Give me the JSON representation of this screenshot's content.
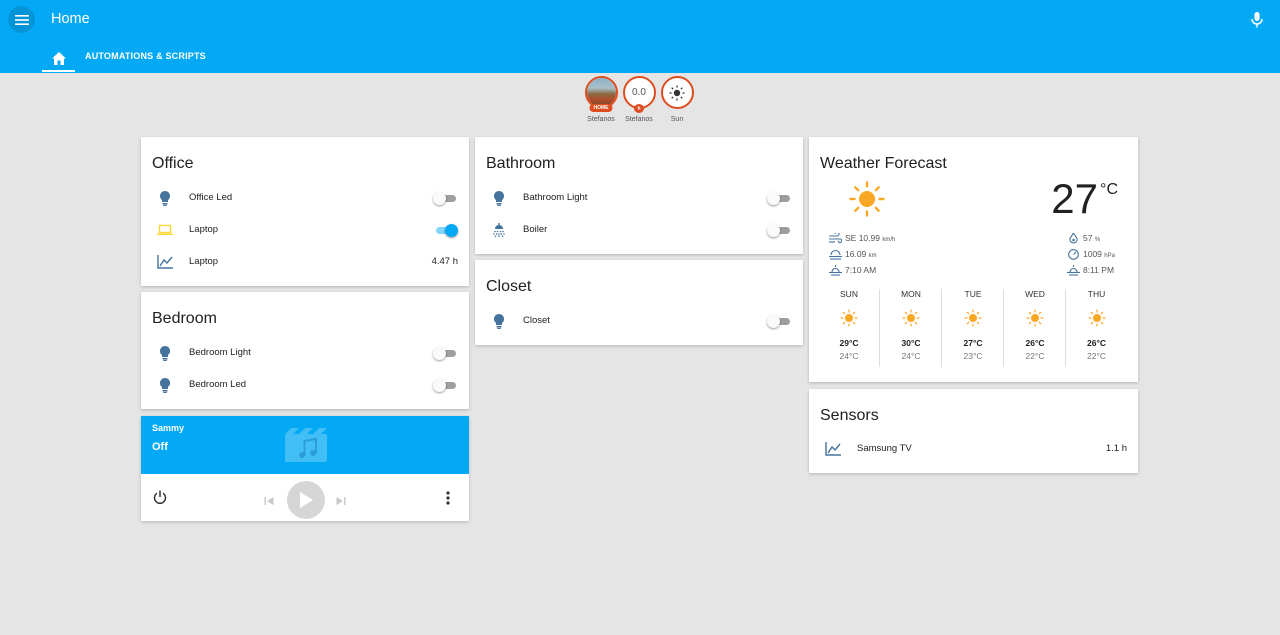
{
  "header": {
    "title": "Home",
    "tabs": [
      {
        "label": "AUTOMATIONS & SCRIPTS"
      }
    ]
  },
  "badges": [
    {
      "label": "Stefanos",
      "tag": "HOME"
    },
    {
      "label": "Stefanos",
      "value": "0.0",
      "unit": "h"
    },
    {
      "label": "Sun"
    }
  ],
  "office": {
    "title": "Office",
    "rows": [
      {
        "label": "Office Led",
        "state": "off"
      },
      {
        "label": "Laptop",
        "state": "on"
      },
      {
        "label": "Laptop",
        "value": "4.47 h"
      }
    ]
  },
  "bedroom": {
    "title": "Bedroom",
    "rows": [
      {
        "label": "Bedroom Light",
        "state": "off"
      },
      {
        "label": "Bedroom Led",
        "state": "off"
      }
    ]
  },
  "media": {
    "name": "Sammy",
    "state": "Off"
  },
  "bathroom": {
    "title": "Bathroom",
    "rows": [
      {
        "label": "Bathroom Light",
        "state": "off"
      },
      {
        "label": "Boiler",
        "state": "off"
      }
    ]
  },
  "closet": {
    "title": "Closet",
    "rows": [
      {
        "label": "Closet",
        "state": "off"
      }
    ]
  },
  "weather": {
    "title": "Weather Forecast",
    "temperature": "27",
    "unit": "°C",
    "wind": {
      "text": "SE 10.99",
      "unit": "km/h"
    },
    "visibility": {
      "text": "16.09",
      "unit": "km"
    },
    "sunrise": "7:10 AM",
    "humidity": {
      "text": "57",
      "unit": "%"
    },
    "pressure": {
      "text": "1009",
      "unit": "hPa"
    },
    "sunset": "8:11 PM",
    "forecast": [
      {
        "day": "SUN",
        "high": "29°C",
        "low": "24°C"
      },
      {
        "day": "MON",
        "high": "30°C",
        "low": "24°C"
      },
      {
        "day": "TUE",
        "high": "27°C",
        "low": "23°C"
      },
      {
        "day": "WED",
        "high": "26°C",
        "low": "22°C"
      },
      {
        "day": "THU",
        "high": "26°C",
        "low": "22°C"
      }
    ]
  },
  "sensors": {
    "title": "Sensors",
    "rows": [
      {
        "label": "Samsung TV",
        "value": "1.1 h"
      }
    ]
  },
  "colors": {
    "primary": "#03a9f4",
    "badge_border": "#df4c1e",
    "icon_blue": "#44739e",
    "icon_yellow": "#fdd835",
    "sun_orange": "#f9a825"
  }
}
